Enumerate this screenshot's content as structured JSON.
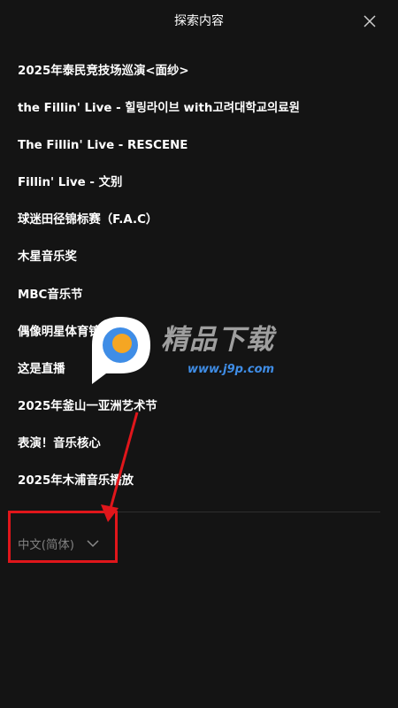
{
  "header": {
    "title": "探索内容",
    "close_icon": "close-icon"
  },
  "menu": {
    "items": [
      {
        "label": "2025年泰民竞技场巡演<面纱>"
      },
      {
        "label": "the Fillin' Live - 힐링라이브 with고려대학교의료원"
      },
      {
        "label": "The Fillin' Live - RESCENE"
      },
      {
        "label": "Fillin' Live - 文别"
      },
      {
        "label": "球迷田径锦标赛（F.A.C）"
      },
      {
        "label": "木星音乐奖"
      },
      {
        "label": "MBC音乐节"
      },
      {
        "label": "偶像明星体育锦标赛"
      },
      {
        "label": "这是直播"
      },
      {
        "label": "2025年釜山一亚洲艺术节"
      },
      {
        "label": "表演！音乐核心"
      },
      {
        "label": "2025年木浦音乐播放"
      }
    ]
  },
  "language": {
    "selected": "中文(简体)",
    "icon": "chevron-down-icon"
  },
  "watermark": {
    "brand": "精品下载",
    "url": "www.j9p.com"
  },
  "colors": {
    "background": "#141414",
    "text": "#ffffff",
    "muted": "#808080",
    "annotation": "#e0161b"
  }
}
